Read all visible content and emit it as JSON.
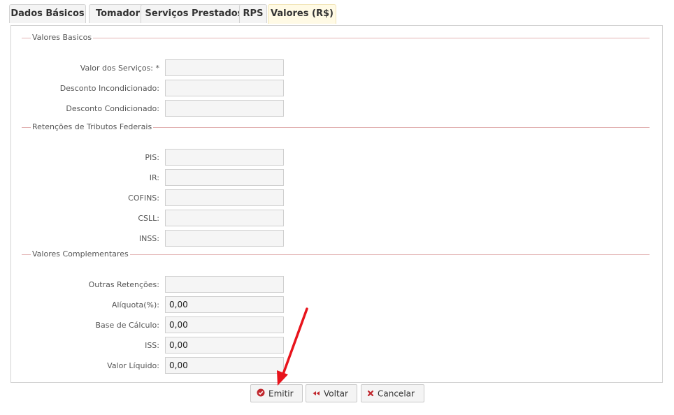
{
  "tabs": [
    {
      "label": "Dados Básicos"
    },
    {
      "label": "Tomador"
    },
    {
      "label": "Serviços Prestados"
    },
    {
      "label": "RPS"
    },
    {
      "label": "Valores (R$)",
      "active": true
    }
  ],
  "sections": {
    "basicos": {
      "title": "Valores Basicos",
      "fields": [
        {
          "label": "Valor dos Serviços: *",
          "value": ""
        },
        {
          "label": "Desconto Incondicionado:",
          "value": ""
        },
        {
          "label": "Desconto Condicionado:",
          "value": ""
        }
      ]
    },
    "retencoes": {
      "title": "Retenções de Tributos Federais",
      "fields": [
        {
          "label": "PIS:",
          "value": ""
        },
        {
          "label": "IR:",
          "value": ""
        },
        {
          "label": "COFINS:",
          "value": ""
        },
        {
          "label": "CSLL:",
          "value": ""
        },
        {
          "label": "INSS:",
          "value": ""
        }
      ]
    },
    "complementares": {
      "title": "Valores Complementares",
      "fields": [
        {
          "label": "Outras Retenções:",
          "value": ""
        },
        {
          "label": "Alíquota(%):",
          "value": "0,00"
        },
        {
          "label": "Base de Cálculo:",
          "value": "0,00"
        },
        {
          "label": "ISS:",
          "value": "0,00"
        },
        {
          "label": "Valor Líquido:",
          "value": "0,00"
        }
      ]
    }
  },
  "buttons": {
    "emitir": "Emitir",
    "voltar": "Voltar",
    "cancelar": "Cancelar"
  },
  "colors": {
    "accent_red": "#c0272d",
    "annotation_arrow": "#e8141c",
    "active_tab_bg": "#fffae5"
  }
}
